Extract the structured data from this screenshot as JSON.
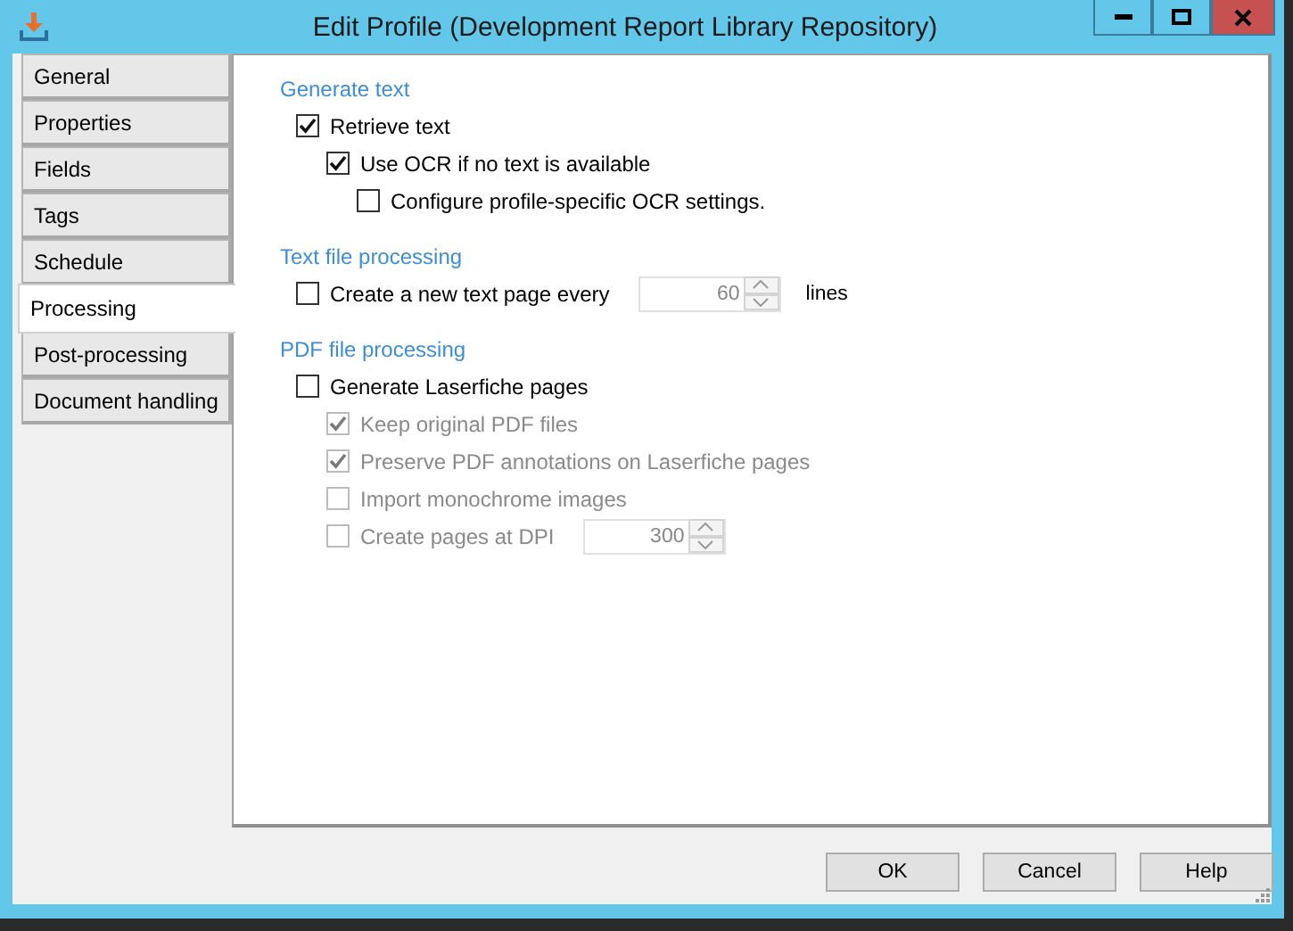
{
  "window": {
    "title": "Edit Profile (Development Report Library Repository)"
  },
  "tabs": [
    {
      "label": "General",
      "selected": false
    },
    {
      "label": "Properties",
      "selected": false
    },
    {
      "label": "Fields",
      "selected": false
    },
    {
      "label": "Tags",
      "selected": false
    },
    {
      "label": "Schedule",
      "selected": false
    },
    {
      "label": "Processing",
      "selected": true
    },
    {
      "label": "Post-processing",
      "selected": false
    },
    {
      "label": "Document handling",
      "selected": false
    }
  ],
  "sections": [
    {
      "title": "Generate text",
      "options": [
        {
          "label": "Retrieve text",
          "checked": true,
          "disabled": false,
          "children": [
            {
              "label": "Use OCR if no text is available",
              "checked": true,
              "disabled": false,
              "children": [
                {
                  "label": "Configure profile-specific OCR settings.",
                  "checked": false,
                  "disabled": false
                }
              ]
            }
          ]
        }
      ]
    },
    {
      "title": "Text file processing",
      "options": [
        {
          "label": "Create a new text page every",
          "checked": false,
          "disabled": false,
          "spinner": {
            "value": "60",
            "disabled": true
          },
          "suffix": "lines"
        }
      ]
    },
    {
      "title": "PDF file processing",
      "options": [
        {
          "label": "Generate Laserfiche pages",
          "checked": false,
          "disabled": false,
          "children": [
            {
              "label": "Keep original PDF files",
              "checked": true,
              "disabled": true
            },
            {
              "label": "Preserve PDF annotations on Laserfiche pages",
              "checked": true,
              "disabled": true
            },
            {
              "label": "Import monochrome images",
              "checked": false,
              "disabled": true
            },
            {
              "label": "Create pages at DPI",
              "checked": false,
              "disabled": true,
              "spinner": {
                "value": "300",
                "disabled": true
              }
            }
          ]
        }
      ]
    }
  ],
  "buttons": [
    "OK",
    "Cancel",
    "Help"
  ]
}
